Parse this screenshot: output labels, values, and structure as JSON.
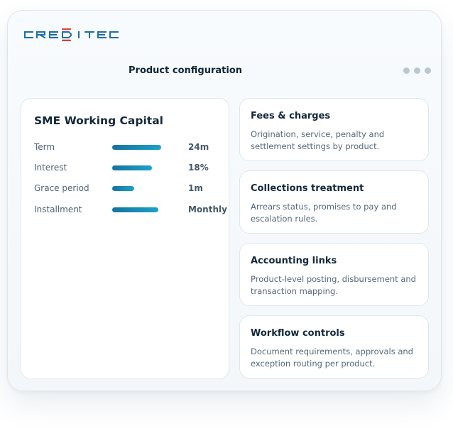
{
  "brand": {
    "logo_text": "CREDITEC",
    "colors": {
      "primary": "#1c6fa8",
      "accent": "#e53935"
    }
  },
  "header": {
    "title": "Product configuration",
    "menu_icon": "more-horizontal-icon"
  },
  "product": {
    "title": "SME Working Capital",
    "params": [
      {
        "label": "Term",
        "value": "24m",
        "level": 0.86
      },
      {
        "label": "Interest",
        "value": "18%",
        "level": 0.7
      },
      {
        "label": "Grace period",
        "value": "1m",
        "level": 0.39
      },
      {
        "label": "Installment",
        "value": "Monthly",
        "level": 0.81
      }
    ],
    "bar_color": "#1b8fbc"
  },
  "features": [
    {
      "title": "Fees & charges",
      "description": "Origination, service, penalty and settlement settings by product."
    },
    {
      "title": "Collections treatment",
      "description": "Arrears status, promises to pay and escalation rules."
    },
    {
      "title": "Accounting links",
      "description": "Product-level posting, disbursement and transaction mapping."
    },
    {
      "title": "Workflow controls",
      "description": "Document requirements, approvals and exception routing per product."
    }
  ]
}
